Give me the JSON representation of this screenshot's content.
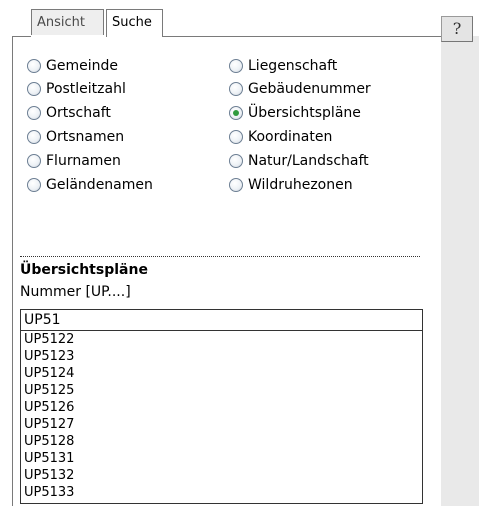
{
  "tabs": [
    {
      "label": "Ansicht",
      "active": false
    },
    {
      "label": "Suche",
      "active": true
    }
  ],
  "help_button": {
    "label": "?"
  },
  "search_types": {
    "left_column": [
      {
        "label": "Gemeinde",
        "checked": false
      },
      {
        "label": "Postleitzahl",
        "checked": false
      },
      {
        "label": "Ortschaft",
        "checked": false
      },
      {
        "label": "Ortsnamen",
        "checked": false
      },
      {
        "label": "Flurnamen",
        "checked": false
      },
      {
        "label": "Geländenamen",
        "checked": false
      }
    ],
    "right_column": [
      {
        "label": "Liegenschaft",
        "checked": false
      },
      {
        "label": "Gebäudenummer",
        "checked": false
      },
      {
        "label": "Übersichtspläne",
        "checked": true
      },
      {
        "label": "Koordinaten",
        "checked": false
      },
      {
        "label": "Natur/Landschaft",
        "checked": false
      },
      {
        "label": "Wildruhezonen",
        "checked": false
      }
    ]
  },
  "section": {
    "title": "Übersichtspläne",
    "field_label": "Nummer [UP....]",
    "input_value": "UP51"
  },
  "results": [
    "UP5122",
    "UP5123",
    "UP5124",
    "UP5125",
    "UP5126",
    "UP5127",
    "UP5128",
    "UP5131",
    "UP5132",
    "UP5133"
  ]
}
